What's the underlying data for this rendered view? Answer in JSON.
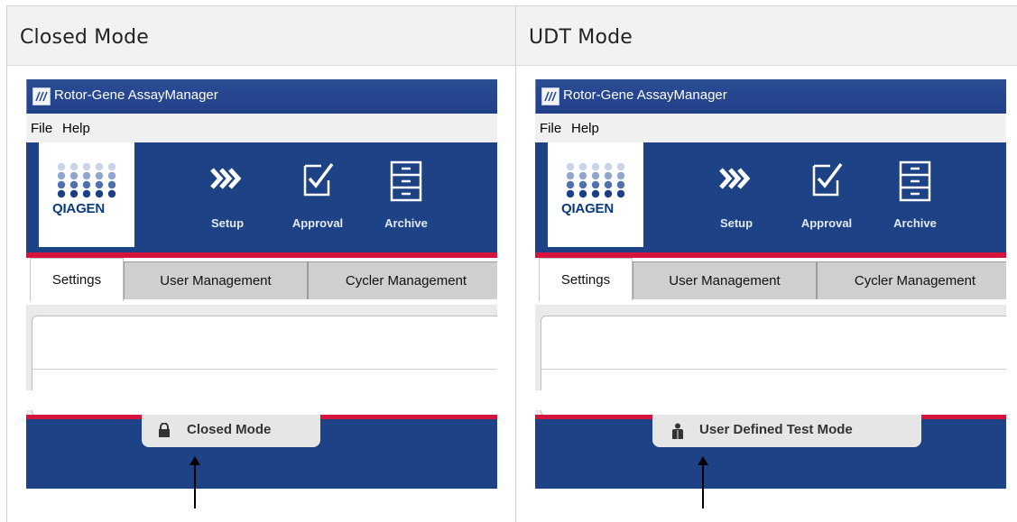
{
  "headings": {
    "left": "Closed Mode",
    "right": "UDT Mode"
  },
  "app": {
    "title": "Rotor-Gene AssayManager",
    "menu": [
      "File",
      "Help"
    ],
    "logo_text": "QIAGEN",
    "nav": [
      "Setup",
      "Approval",
      "Archive"
    ],
    "tabs": [
      "Settings",
      "User Management",
      "Cycler Management"
    ]
  },
  "status": {
    "left": {
      "label": "Closed Mode",
      "icon": "lock-icon"
    },
    "right": {
      "label": "User Defined Test Mode",
      "icon": "user-icon"
    }
  },
  "colors": {
    "ribbon_blue": "#1d4286",
    "accent_red": "#d4143c",
    "logo_blue": "#0a3b7b"
  }
}
